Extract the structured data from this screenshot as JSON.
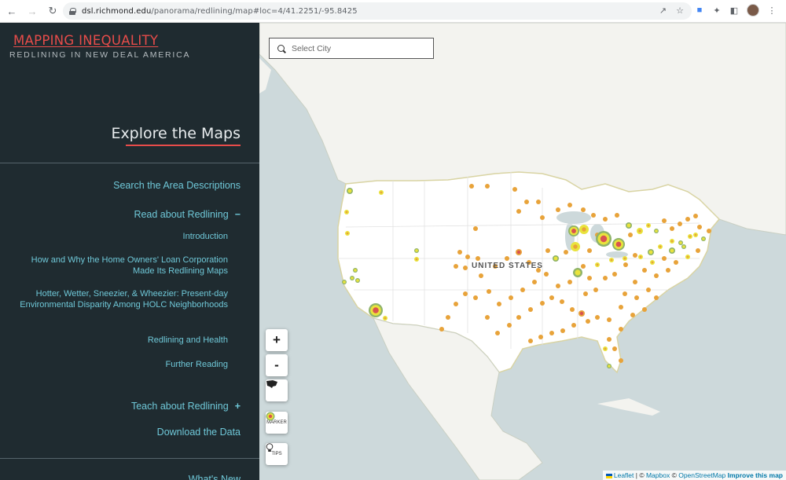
{
  "browser": {
    "url_host": "dsl.richmond.edu",
    "url_path": "/panorama/redlining/map#loc=4/41.2251/-95.8425"
  },
  "sidebar": {
    "brand_title": "MAPPING INEQUALITY",
    "brand_subtitle": "REDLINING IN NEW DEAL AMERICA",
    "section_title": "Explore the Maps",
    "links": {
      "search": "Search the Area Descriptions",
      "read": "Read about Redlining",
      "read_toggle": "−",
      "teach": "Teach about Redlining",
      "teach_toggle": "+",
      "download": "Download the Data",
      "whats_new": "What's New"
    },
    "read_sublinks": [
      "Introduction",
      "How and Why the Home Owners' Loan Corporation Made Its Redlining Maps",
      "Hotter, Wetter, Sneezier, & Wheezier: Present-day Environmental Disparity Among HOLC Neighborhoods",
      "Redlining and Health",
      "Further Reading"
    ],
    "colors": {
      "background": "#1f2b30",
      "accent": "#e74c4a",
      "link": "#6fc8d8"
    }
  },
  "map": {
    "search_placeholder": "Select City",
    "country_label": "UNITED STATES",
    "controls": {
      "zoom_in": "+",
      "zoom_out": "-",
      "usa_icon": "usa-shape-icon",
      "marker_label": "MARKER",
      "tips_label": "TIPS"
    },
    "attribution": {
      "leaflet": "Leaflet",
      "sep1": " | © ",
      "mapbox": "Mapbox",
      "sep2": " © ",
      "osm": "OpenStreetMap",
      "improve": "Improve this map"
    },
    "colors": {
      "water": "#cdd9db",
      "land": "#f2f2ef",
      "usa": "#ffffff",
      "marker": "#e8a33a",
      "marker_yellow": "#e9e33c",
      "marker_green": "#8fb36a",
      "marker_red": "#d9534f"
    }
  }
}
